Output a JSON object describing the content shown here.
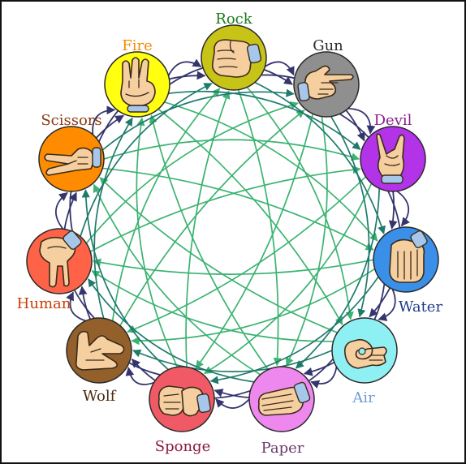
{
  "colors": {
    "edge_dark": "#35356e",
    "edge_mid": "#1f7a6c",
    "edge_light": "#3cb371"
  },
  "nodes": [
    {
      "key": "rock",
      "label": "Rock",
      "circle_color": "#c8c417",
      "label_color": "#1b7a18",
      "icon": "fist-hand-icon"
    },
    {
      "key": "gun",
      "label": "Gun",
      "circle_color": "#8f8f8f",
      "label_color": "#2b2b2b",
      "icon": "finger-gun-hand-icon"
    },
    {
      "key": "devil",
      "label": "Devil",
      "circle_color": "#b233e8",
      "label_color": "#8a1e8a",
      "icon": "horns-hand-icon"
    },
    {
      "key": "water",
      "label": "Water",
      "circle_color": "#3a8fe8",
      "label_color": "#1f3c8a",
      "icon": "cupped-hand-icon"
    },
    {
      "key": "air",
      "label": "Air",
      "circle_color": "#8ff0f4",
      "label_color": "#6f9fcf",
      "icon": "ok-sign-hand-icon"
    },
    {
      "key": "paper",
      "label": "Paper",
      "circle_color": "#ee88ee",
      "label_color": "#6a3a6a",
      "icon": "flat-hand-icon"
    },
    {
      "key": "sponge",
      "label": "Sponge",
      "circle_color": "#f05a66",
      "label_color": "#8a1a3a",
      "icon": "squeezing-hand-icon"
    },
    {
      "key": "wolf",
      "label": "Wolf",
      "circle_color": "#93602c",
      "label_color": "#4a2a10",
      "icon": "wolf-shadow-hand-icon"
    },
    {
      "key": "human",
      "label": "Human",
      "circle_color": "#ff6347",
      "label_color": "#c8400a",
      "icon": "walking-fingers-hand-icon"
    },
    {
      "key": "scissors",
      "label": "Scissors",
      "circle_color": "#ff8c00",
      "label_color": "#8b3a10",
      "icon": "scissors-hand-icon"
    },
    {
      "key": "fire",
      "label": "Fire",
      "circle_color": "#ffff0f",
      "label_color": "#f08c00",
      "icon": "three-fingers-hand-icon"
    }
  ],
  "rule": "each gesture beats the five gestures that follow it clockwise"
}
